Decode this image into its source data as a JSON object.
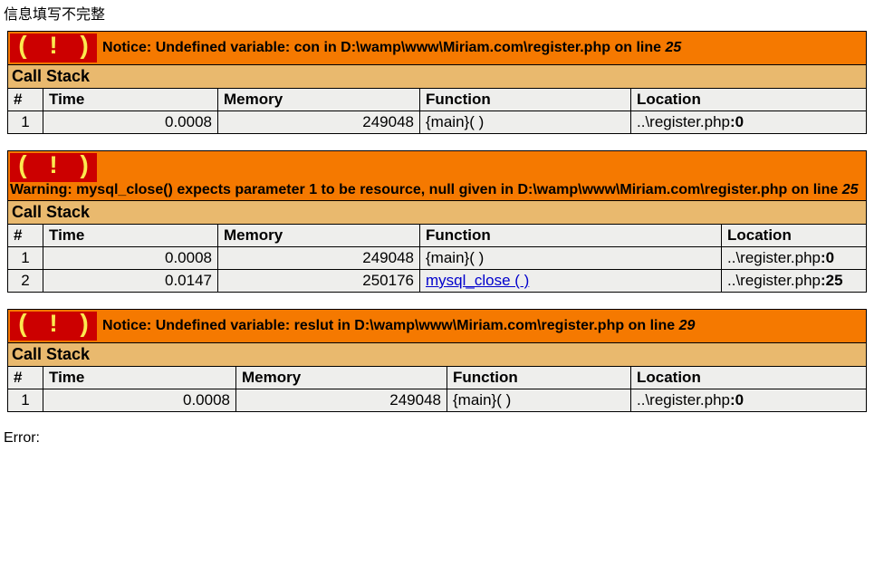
{
  "top_message": "信息填写不完整",
  "bottom_message": "Error:",
  "errors": [
    {
      "icon": "( ! )",
      "message_parts": [
        "Notice: Undefined variable: con in D:\\wamp\\www\\Miriam.com\\register.php on line ",
        "25"
      ],
      "callstack_title": "Call Stack",
      "headers": {
        "num": "#",
        "time": "Time",
        "memory": "Memory",
        "function": "Function",
        "location": "Location"
      },
      "rows": [
        {
          "num": "1",
          "time": "0.0008",
          "memory": "249048",
          "function": "{main}( )",
          "is_link": false,
          "location_pre": "..\\register.php",
          "location_line": ":0"
        }
      ]
    },
    {
      "icon": "( ! )",
      "message_parts": [
        "Warning: mysql_close() expects parameter 1 to be resource, null given in D:\\wamp\\www\\Miriam.com\\register.php on line ",
        "25"
      ],
      "callstack_title": "Call Stack",
      "headers": {
        "num": "#",
        "time": "Time",
        "memory": "Memory",
        "function": "Function",
        "location": "Location"
      },
      "rows": [
        {
          "num": "1",
          "time": "0.0008",
          "memory": "249048",
          "function": "{main}( )",
          "is_link": false,
          "location_pre": "..\\register.php",
          "location_line": ":0"
        },
        {
          "num": "2",
          "time": "0.0147",
          "memory": "250176",
          "function": "mysql_close ( )",
          "is_link": true,
          "location_pre": "..\\register.php",
          "location_line": ":25"
        }
      ]
    },
    {
      "icon": "( ! )",
      "message_parts": [
        "Notice: Undefined variable: reslut in D:\\wamp\\www\\Miriam.com\\register.php on line ",
        "29"
      ],
      "callstack_title": "Call Stack",
      "headers": {
        "num": "#",
        "time": "Time",
        "memory": "Memory",
        "function": "Function",
        "location": "Location"
      },
      "rows": [
        {
          "num": "1",
          "time": "0.0008",
          "memory": "249048",
          "function": "{main}( )",
          "is_link": false,
          "location_pre": "..\\register.php",
          "location_line": ":0"
        }
      ]
    }
  ],
  "col_widths": [
    {
      "time": "180px",
      "mem": "210px",
      "func": "220px"
    },
    {
      "time": "180px",
      "mem": "210px",
      "func": "320px"
    },
    {
      "time": "200px",
      "mem": "220px",
      "func": "190px"
    }
  ]
}
